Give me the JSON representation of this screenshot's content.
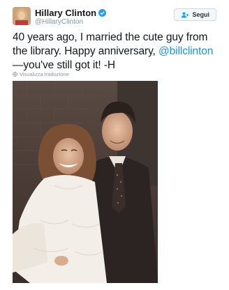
{
  "tweet": {
    "author": {
      "display_name": "Hillary Clinton",
      "handle": "@HillaryClinton",
      "verified": true,
      "avatar_icon": "profile-photo"
    },
    "follow_button": {
      "label": "Segui",
      "icon": "add-person-icon"
    },
    "text_parts": {
      "part1": "40 years ago, I married the cute guy from the library. Happy anniversary, ",
      "mention": "@billclinton",
      "part2": "—you've still got it! -H"
    },
    "translate_link": "Visualizza traduzione",
    "media": {
      "description_icon": "wedding-photo"
    },
    "colors": {
      "link": "#1b95e0",
      "muted": "#8899a6",
      "text": "#14171a"
    }
  }
}
